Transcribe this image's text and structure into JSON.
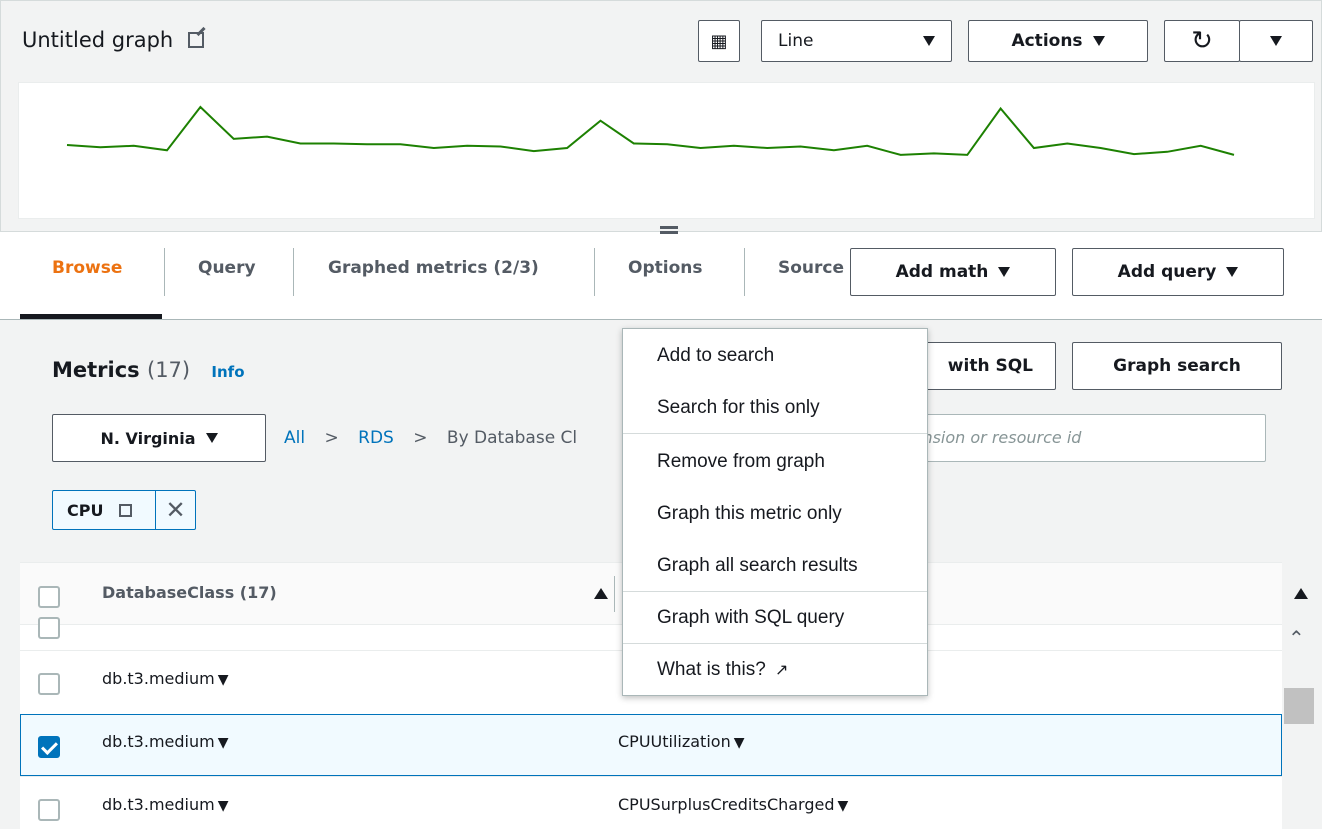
{
  "header": {
    "title": "Untitled graph",
    "chart_type_value": "Line",
    "actions_label": "Actions"
  },
  "tabs": [
    {
      "label": "Browse"
    },
    {
      "label": "Query"
    },
    {
      "label": "Graphed metrics (2/3)"
    },
    {
      "label": "Options"
    },
    {
      "label": "Source"
    }
  ],
  "tab_buttons": {
    "add_math": "Add math",
    "add_query": "Add query"
  },
  "metrics": {
    "title": "Metrics",
    "count": "(17)",
    "info": "Info",
    "sql_btn_partial": "with SQL",
    "graph_search": "Graph search",
    "region": "N. Virginia",
    "crumbs": [
      "All",
      "RDS",
      "By Database Cl"
    ],
    "search_placeholder": "ic, dimension or resource id",
    "token": "CPU"
  },
  "table": {
    "col1_header": "DatabaseClass (17)",
    "rows": [
      {
        "db": "db.t3.medium",
        "metric": "",
        "checked": false
      },
      {
        "db": "db.t3.medium",
        "metric": "CPUUtilization",
        "checked": true
      },
      {
        "db": "db.t3.medium",
        "metric": "CPUSurplusCreditsCharged",
        "checked": false
      }
    ]
  },
  "context_menu": {
    "items": [
      "Add to search",
      "Search for this only",
      "Remove from graph",
      "Graph this metric only",
      "Graph all search results",
      "Graph with SQL query",
      "What is this?"
    ]
  },
  "chart_data": {
    "type": "line",
    "color": "#1d8102",
    "values": [
      0.5,
      0.47,
      0.49,
      0.43,
      1.0,
      0.58,
      0.61,
      0.52,
      0.52,
      0.51,
      0.51,
      0.46,
      0.49,
      0.48,
      0.42,
      0.46,
      0.82,
      0.52,
      0.51,
      0.46,
      0.49,
      0.46,
      0.48,
      0.43,
      0.49,
      0.37,
      0.39,
      0.37,
      0.98,
      0.46,
      0.52,
      0.46,
      0.38,
      0.41,
      0.49,
      0.37
    ]
  }
}
